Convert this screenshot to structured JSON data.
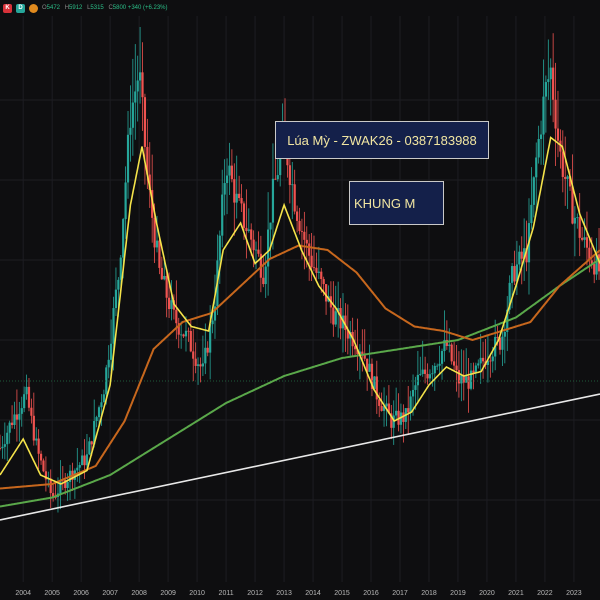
{
  "topbar": {
    "interval": "D",
    "ohlc": [
      {
        "k": "O",
        "v": "5472"
      },
      {
        "k": "H",
        "v": "5912"
      },
      {
        "k": "L",
        "v": "5315"
      },
      {
        "k": "C",
        "v": "5800 +340 (+6.23%)"
      }
    ]
  },
  "annotations": {
    "title": "Lúa Mỳ - ZWAK26 - 0387183988",
    "frame": "KHUNG M"
  },
  "colors": {
    "background": "#0e0e10",
    "grid": "#1d1d22",
    "up": "#26a69a",
    "down": "#ef5350",
    "ma_fast": "#f5e34a",
    "ma_mid": "#c7671d",
    "ma_slow": "#5aa84a",
    "trendline": "#e8e8e8"
  },
  "chart_data": {
    "type": "candlestick",
    "xlabels": [
      "2004",
      "2005",
      "2006",
      "2007",
      "2008",
      "2009",
      "2010",
      "2011",
      "2012",
      "2013",
      "2014",
      "2015",
      "2016",
      "2017",
      "2018",
      "2019",
      "2020",
      "2021",
      "2022",
      "2023"
    ],
    "x_range": [
      2003.2,
      2023.9
    ],
    "price_path": [
      [
        2003.2,
        0.16
      ],
      [
        2003.6,
        0.22
      ],
      [
        2004.1,
        0.28
      ],
      [
        2004.5,
        0.15
      ],
      [
        2005.0,
        0.05
      ],
      [
        2005.6,
        0.1
      ],
      [
        2006.2,
        0.14
      ],
      [
        2006.8,
        0.3
      ],
      [
        2007.3,
        0.55
      ],
      [
        2007.7,
        0.9
      ],
      [
        2008.0,
        1.0
      ],
      [
        2008.3,
        0.75
      ],
      [
        2008.7,
        0.55
      ],
      [
        2009.2,
        0.45
      ],
      [
        2009.7,
        0.4
      ],
      [
        2010.2,
        0.33
      ],
      [
        2010.6,
        0.48
      ],
      [
        2011.0,
        0.8
      ],
      [
        2011.4,
        0.7
      ],
      [
        2011.9,
        0.62
      ],
      [
        2012.3,
        0.55
      ],
      [
        2012.6,
        0.72
      ],
      [
        2013.0,
        0.85
      ],
      [
        2013.4,
        0.7
      ],
      [
        2013.8,
        0.6
      ],
      [
        2014.3,
        0.52
      ],
      [
        2014.7,
        0.46
      ],
      [
        2015.2,
        0.42
      ],
      [
        2015.7,
        0.38
      ],
      [
        2016.2,
        0.28
      ],
      [
        2016.7,
        0.22
      ],
      [
        2017.2,
        0.23
      ],
      [
        2017.6,
        0.31
      ],
      [
        2018.1,
        0.34
      ],
      [
        2018.6,
        0.39
      ],
      [
        2019.0,
        0.31
      ],
      [
        2019.5,
        0.31
      ],
      [
        2020.0,
        0.37
      ],
      [
        2020.5,
        0.4
      ],
      [
        2020.9,
        0.55
      ],
      [
        2021.4,
        0.6
      ],
      [
        2021.7,
        0.8
      ],
      [
        2022.0,
        0.95
      ],
      [
        2022.2,
        1.0
      ],
      [
        2022.5,
        0.82
      ],
      [
        2022.9,
        0.7
      ],
      [
        2023.3,
        0.62
      ],
      [
        2023.9,
        0.55
      ]
    ],
    "ma_fast": [
      [
        2003.2,
        0.1
      ],
      [
        2004.0,
        0.18
      ],
      [
        2004.6,
        0.1
      ],
      [
        2005.3,
        0.08
      ],
      [
        2006.2,
        0.11
      ],
      [
        2007.0,
        0.3
      ],
      [
        2007.7,
        0.7
      ],
      [
        2008.1,
        0.83
      ],
      [
        2008.6,
        0.66
      ],
      [
        2009.2,
        0.48
      ],
      [
        2009.8,
        0.43
      ],
      [
        2010.4,
        0.42
      ],
      [
        2010.9,
        0.6
      ],
      [
        2011.5,
        0.66
      ],
      [
        2012.0,
        0.57
      ],
      [
        2012.5,
        0.6
      ],
      [
        2013.0,
        0.7
      ],
      [
        2013.6,
        0.6
      ],
      [
        2014.2,
        0.52
      ],
      [
        2014.8,
        0.47
      ],
      [
        2015.4,
        0.4
      ],
      [
        2016.1,
        0.29
      ],
      [
        2016.8,
        0.22
      ],
      [
        2017.4,
        0.24
      ],
      [
        2018.0,
        0.3
      ],
      [
        2018.6,
        0.34
      ],
      [
        2019.2,
        0.32
      ],
      [
        2019.8,
        0.33
      ],
      [
        2020.4,
        0.4
      ],
      [
        2021.0,
        0.52
      ],
      [
        2021.6,
        0.65
      ],
      [
        2022.2,
        0.85
      ],
      [
        2022.6,
        0.83
      ],
      [
        2023.2,
        0.68
      ],
      [
        2023.9,
        0.57
      ]
    ],
    "ma_mid": [
      [
        2003.2,
        0.07
      ],
      [
        2005.0,
        0.08
      ],
      [
        2006.5,
        0.12
      ],
      [
        2007.5,
        0.22
      ],
      [
        2008.5,
        0.38
      ],
      [
        2009.5,
        0.44
      ],
      [
        2010.5,
        0.46
      ],
      [
        2011.5,
        0.52
      ],
      [
        2012.5,
        0.58
      ],
      [
        2013.5,
        0.61
      ],
      [
        2014.5,
        0.6
      ],
      [
        2015.5,
        0.55
      ],
      [
        2016.5,
        0.47
      ],
      [
        2017.5,
        0.43
      ],
      [
        2018.5,
        0.42
      ],
      [
        2019.5,
        0.4
      ],
      [
        2020.5,
        0.42
      ],
      [
        2021.5,
        0.44
      ],
      [
        2022.5,
        0.52
      ],
      [
        2023.9,
        0.6
      ]
    ],
    "ma_slow": [
      [
        2003.2,
        0.03
      ],
      [
        2005.0,
        0.05
      ],
      [
        2007.0,
        0.1
      ],
      [
        2009.0,
        0.18
      ],
      [
        2011.0,
        0.26
      ],
      [
        2013.0,
        0.32
      ],
      [
        2015.0,
        0.36
      ],
      [
        2017.0,
        0.38
      ],
      [
        2019.0,
        0.4
      ],
      [
        2021.0,
        0.45
      ],
      [
        2022.5,
        0.52
      ],
      [
        2023.9,
        0.58
      ]
    ],
    "trendline": [
      [
        2003.2,
        0.0
      ],
      [
        2023.9,
        0.28
      ]
    ]
  }
}
